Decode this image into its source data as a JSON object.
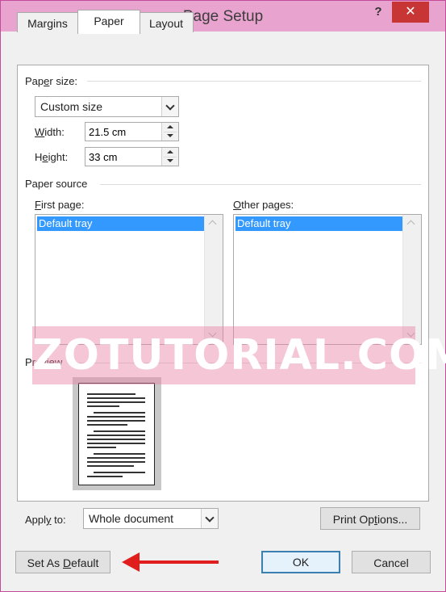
{
  "window": {
    "title": "Page Setup",
    "help": "?",
    "close": "✕"
  },
  "tabs": [
    {
      "label": "Margins"
    },
    {
      "label": "Paper"
    },
    {
      "label": "Layout"
    }
  ],
  "paper_size": {
    "group_label": "Paper size:",
    "selected": "Custom size",
    "width_label": "Width:",
    "width_value": "21.5 cm",
    "height_label": "Height:",
    "height_value": "33 cm"
  },
  "paper_source": {
    "group_label": "Paper source",
    "first_page_label": "First page:",
    "first_page_selected": "Default tray",
    "other_pages_label": "Other pages:",
    "other_pages_selected": "Default tray"
  },
  "watermark": "ZOTUTORIAL.COM",
  "preview": {
    "label": "Preview"
  },
  "apply_to": {
    "label": "Apply to:",
    "value": "Whole document"
  },
  "buttons": {
    "print_options": "Print Options...",
    "set_default": "Set As Default",
    "ok": "OK",
    "cancel": "Cancel"
  },
  "colors": {
    "titlebar": "#e9a3cf",
    "close": "#c73534",
    "selection": "#3399ff",
    "arrow": "#e01e1e"
  }
}
